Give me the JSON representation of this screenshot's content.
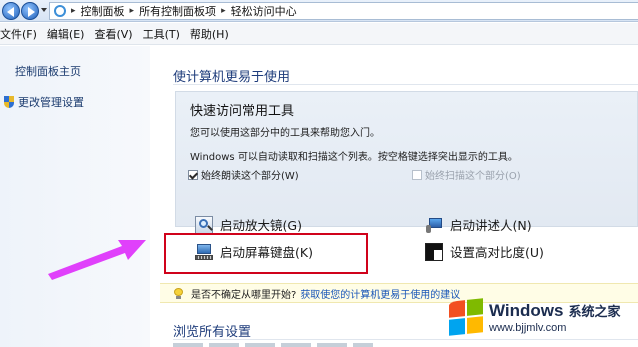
{
  "address_bar": {
    "breadcrumbs": [
      "控制面板",
      "所有控制面板项",
      "轻松访问中心"
    ]
  },
  "menu": {
    "items": [
      "文件(F)",
      "编辑(E)",
      "查看(V)",
      "工具(T)",
      "帮助(H)"
    ]
  },
  "sidebar": {
    "home_label": "控制面板主页",
    "admin_label": "更改管理设置"
  },
  "content": {
    "title": "使计算机更易于使用",
    "quick": {
      "title": "快速访问常用工具",
      "line1": "您可以使用这部分中的工具来帮助您入门。",
      "line2": "Windows 可以自动读取和扫描这个列表。按空格键选择突出显示的工具。",
      "read_label": "始终朗读这个部分(W)",
      "read_checked": true,
      "scan_label": "始终扫描这个部分(O)",
      "scan_checked": false
    },
    "tools": {
      "magnifier": "启动放大镜(G)",
      "narrator": "启动讲述人(N)",
      "osk": "启动屏幕键盘(K)",
      "high_contrast": "设置高对比度(U)"
    },
    "tip": {
      "question": "是否不确定从哪里开始?",
      "link": "获取使您的计算机更易于使用的建议"
    },
    "browse_title": "浏览所有设置"
  },
  "watermark": {
    "brand": "Windows",
    "cn": "系统之家",
    "url": "www.bjjmlv.com"
  },
  "colors": {
    "highlight_box": "#d0021b",
    "arrow": "#e040fb",
    "link": "#1a56b8"
  }
}
